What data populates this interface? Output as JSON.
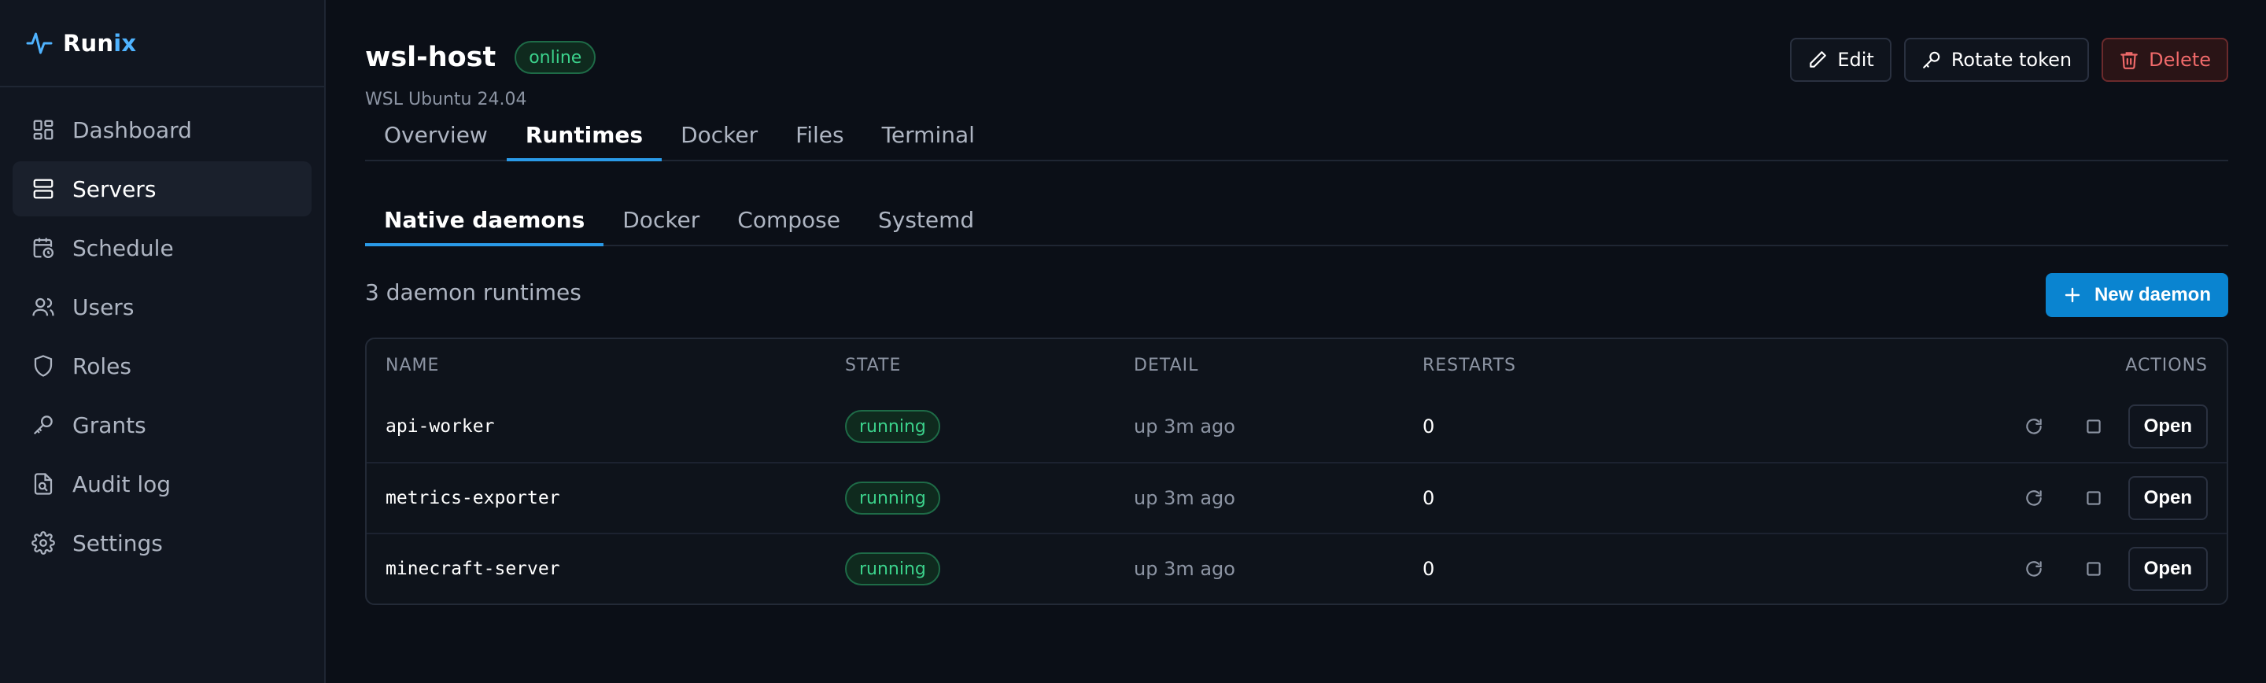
{
  "brand": {
    "name_part1": "Run",
    "name_part2": "ix",
    "accent": "#4fb3ff"
  },
  "sidebar": {
    "items": [
      {
        "label": "Dashboard",
        "icon": "dashboard-icon",
        "active": false
      },
      {
        "label": "Servers",
        "icon": "server-icon",
        "active": true
      },
      {
        "label": "Schedule",
        "icon": "calendar-clock-icon",
        "active": false
      },
      {
        "label": "Users",
        "icon": "users-icon",
        "active": false
      },
      {
        "label": "Roles",
        "icon": "shield-icon",
        "active": false
      },
      {
        "label": "Grants",
        "icon": "key-icon",
        "active": false
      },
      {
        "label": "Audit log",
        "icon": "audit-log-icon",
        "active": false
      },
      {
        "label": "Settings",
        "icon": "gear-icon",
        "active": false
      }
    ]
  },
  "header": {
    "title": "wsl-host",
    "status": "online",
    "subtitle": "WSL Ubuntu 24.04",
    "actions": {
      "edit": "Edit",
      "rotate": "Rotate token",
      "delete": "Delete"
    }
  },
  "tabs": [
    {
      "label": "Overview",
      "active": false
    },
    {
      "label": "Runtimes",
      "active": true
    },
    {
      "label": "Docker",
      "active": false
    },
    {
      "label": "Files",
      "active": false
    },
    {
      "label": "Terminal",
      "active": false
    }
  ],
  "subtabs": [
    {
      "label": "Native daemons",
      "active": true
    },
    {
      "label": "Docker",
      "active": false
    },
    {
      "label": "Compose",
      "active": false
    },
    {
      "label": "Systemd",
      "active": false
    }
  ],
  "runtimes": {
    "count_text": "3 daemon runtimes",
    "new_button": "New daemon",
    "columns": {
      "name": "NAME",
      "state": "STATE",
      "detail": "DETAIL",
      "restarts": "RESTARTS",
      "actions": "ACTIONS"
    },
    "rows": [
      {
        "name": "api-worker",
        "state": "running",
        "detail": "up 3m ago",
        "restarts": "0",
        "open": "Open"
      },
      {
        "name": "metrics-exporter",
        "state": "running",
        "detail": "up 3m ago",
        "restarts": "0",
        "open": "Open"
      },
      {
        "name": "minecraft-server",
        "state": "running",
        "detail": "up 3m ago",
        "restarts": "0",
        "open": "Open"
      }
    ]
  },
  "colors": {
    "background": "#0b0f17",
    "sidebar": "#111620",
    "primary": "#0a84d0",
    "tab_underline": "#2a9ae8",
    "success": "#3bd18b",
    "danger": "#f06a6a"
  }
}
